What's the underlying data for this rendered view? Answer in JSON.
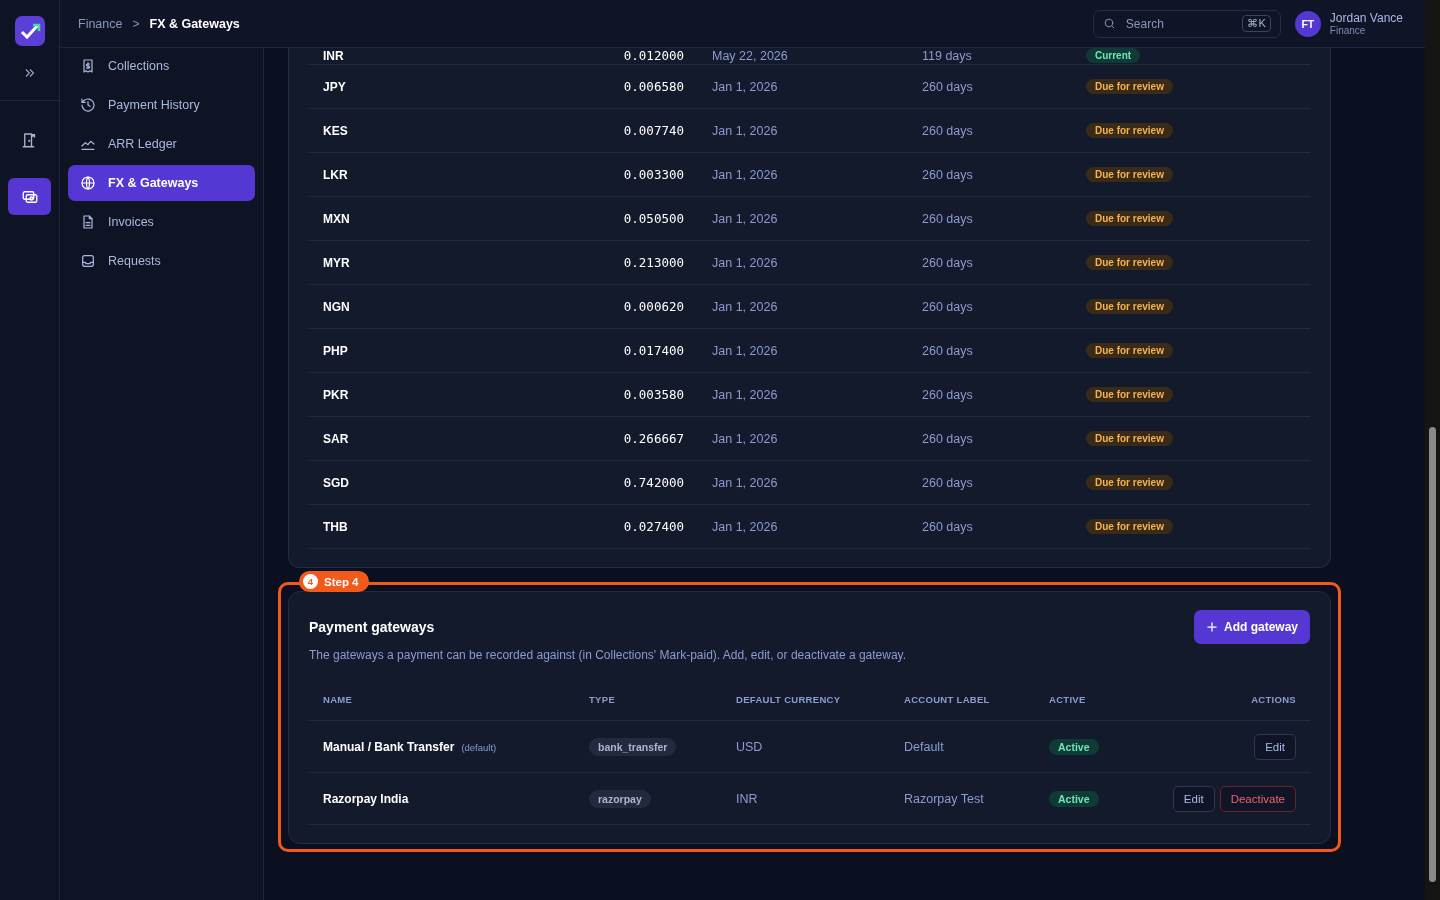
{
  "breadcrumb": {
    "parent": "Finance",
    "separator": ">",
    "current": "FX & Gateways"
  },
  "search": {
    "placeholder": "Search",
    "shortcut": "⌘K"
  },
  "user": {
    "initials": "FT",
    "name": "Jordan Vance",
    "role": "Finance"
  },
  "rail": [
    {
      "selected": false
    },
    {
      "selected": true
    }
  ],
  "sidebar": {
    "items": [
      {
        "label": "Collections",
        "selected": false
      },
      {
        "label": "Payment History",
        "selected": false
      },
      {
        "label": "ARR Ledger",
        "selected": false
      },
      {
        "label": "FX & Gateways",
        "selected": true
      },
      {
        "label": "Invoices",
        "selected": false
      },
      {
        "label": "Requests",
        "selected": false
      }
    ]
  },
  "rates": {
    "rows": [
      {
        "currency": "INR",
        "rate": "0.012000",
        "date": "May 22, 2026",
        "age": "119 days",
        "status": {
          "label": "Current",
          "kind": "current"
        }
      },
      {
        "currency": "JPY",
        "rate": "0.006580",
        "date": "Jan 1, 2026",
        "age": "260 days",
        "status": {
          "label": "Due for review",
          "kind": "due"
        }
      },
      {
        "currency": "KES",
        "rate": "0.007740",
        "date": "Jan 1, 2026",
        "age": "260 days",
        "status": {
          "label": "Due for review",
          "kind": "due"
        }
      },
      {
        "currency": "LKR",
        "rate": "0.003300",
        "date": "Jan 1, 2026",
        "age": "260 days",
        "status": {
          "label": "Due for review",
          "kind": "due"
        }
      },
      {
        "currency": "MXN",
        "rate": "0.050500",
        "date": "Jan 1, 2026",
        "age": "260 days",
        "status": {
          "label": "Due for review",
          "kind": "due"
        }
      },
      {
        "currency": "MYR",
        "rate": "0.213000",
        "date": "Jan 1, 2026",
        "age": "260 days",
        "status": {
          "label": "Due for review",
          "kind": "due"
        }
      },
      {
        "currency": "NGN",
        "rate": "0.000620",
        "date": "Jan 1, 2026",
        "age": "260 days",
        "status": {
          "label": "Due for review",
          "kind": "due"
        }
      },
      {
        "currency": "PHP",
        "rate": "0.017400",
        "date": "Jan 1, 2026",
        "age": "260 days",
        "status": {
          "label": "Due for review",
          "kind": "due"
        }
      },
      {
        "currency": "PKR",
        "rate": "0.003580",
        "date": "Jan 1, 2026",
        "age": "260 days",
        "status": {
          "label": "Due for review",
          "kind": "due"
        }
      },
      {
        "currency": "SAR",
        "rate": "0.266667",
        "date": "Jan 1, 2026",
        "age": "260 days",
        "status": {
          "label": "Due for review",
          "kind": "due"
        }
      },
      {
        "currency": "SGD",
        "rate": "0.742000",
        "date": "Jan 1, 2026",
        "age": "260 days",
        "status": {
          "label": "Due for review",
          "kind": "due"
        }
      },
      {
        "currency": "THB",
        "rate": "0.027400",
        "date": "Jan 1, 2026",
        "age": "260 days",
        "status": {
          "label": "Due for review",
          "kind": "due"
        }
      }
    ]
  },
  "step": {
    "number": "4",
    "label": "Step 4"
  },
  "gateways": {
    "title": "Payment gateways",
    "add_button": "Add gateway",
    "description": "The gateways a payment can be recorded against (in Collections' Mark-paid). Add, edit, or deactivate a gateway.",
    "columns": [
      "NAME",
      "TYPE",
      "DEFAULT CURRENCY",
      "ACCOUNT LABEL",
      "ACTIVE",
      "ACTIONS"
    ],
    "rows": [
      {
        "name": "Manual / Bank Transfer",
        "note": "(default)",
        "type": "bank_transfer",
        "currency": "USD",
        "account_label": "Default",
        "active": {
          "label": "Active",
          "on": true
        },
        "actions": [
          {
            "label": "Edit",
            "kind": "edit"
          }
        ]
      },
      {
        "name": "Razorpay India",
        "type": "razorpay",
        "currency": "INR",
        "account_label": "Razorpay Test",
        "active": {
          "label": "Active",
          "on": true
        },
        "actions": [
          {
            "label": "Edit",
            "kind": "edit"
          },
          {
            "label": "Deactivate",
            "kind": "danger"
          }
        ]
      }
    ]
  }
}
